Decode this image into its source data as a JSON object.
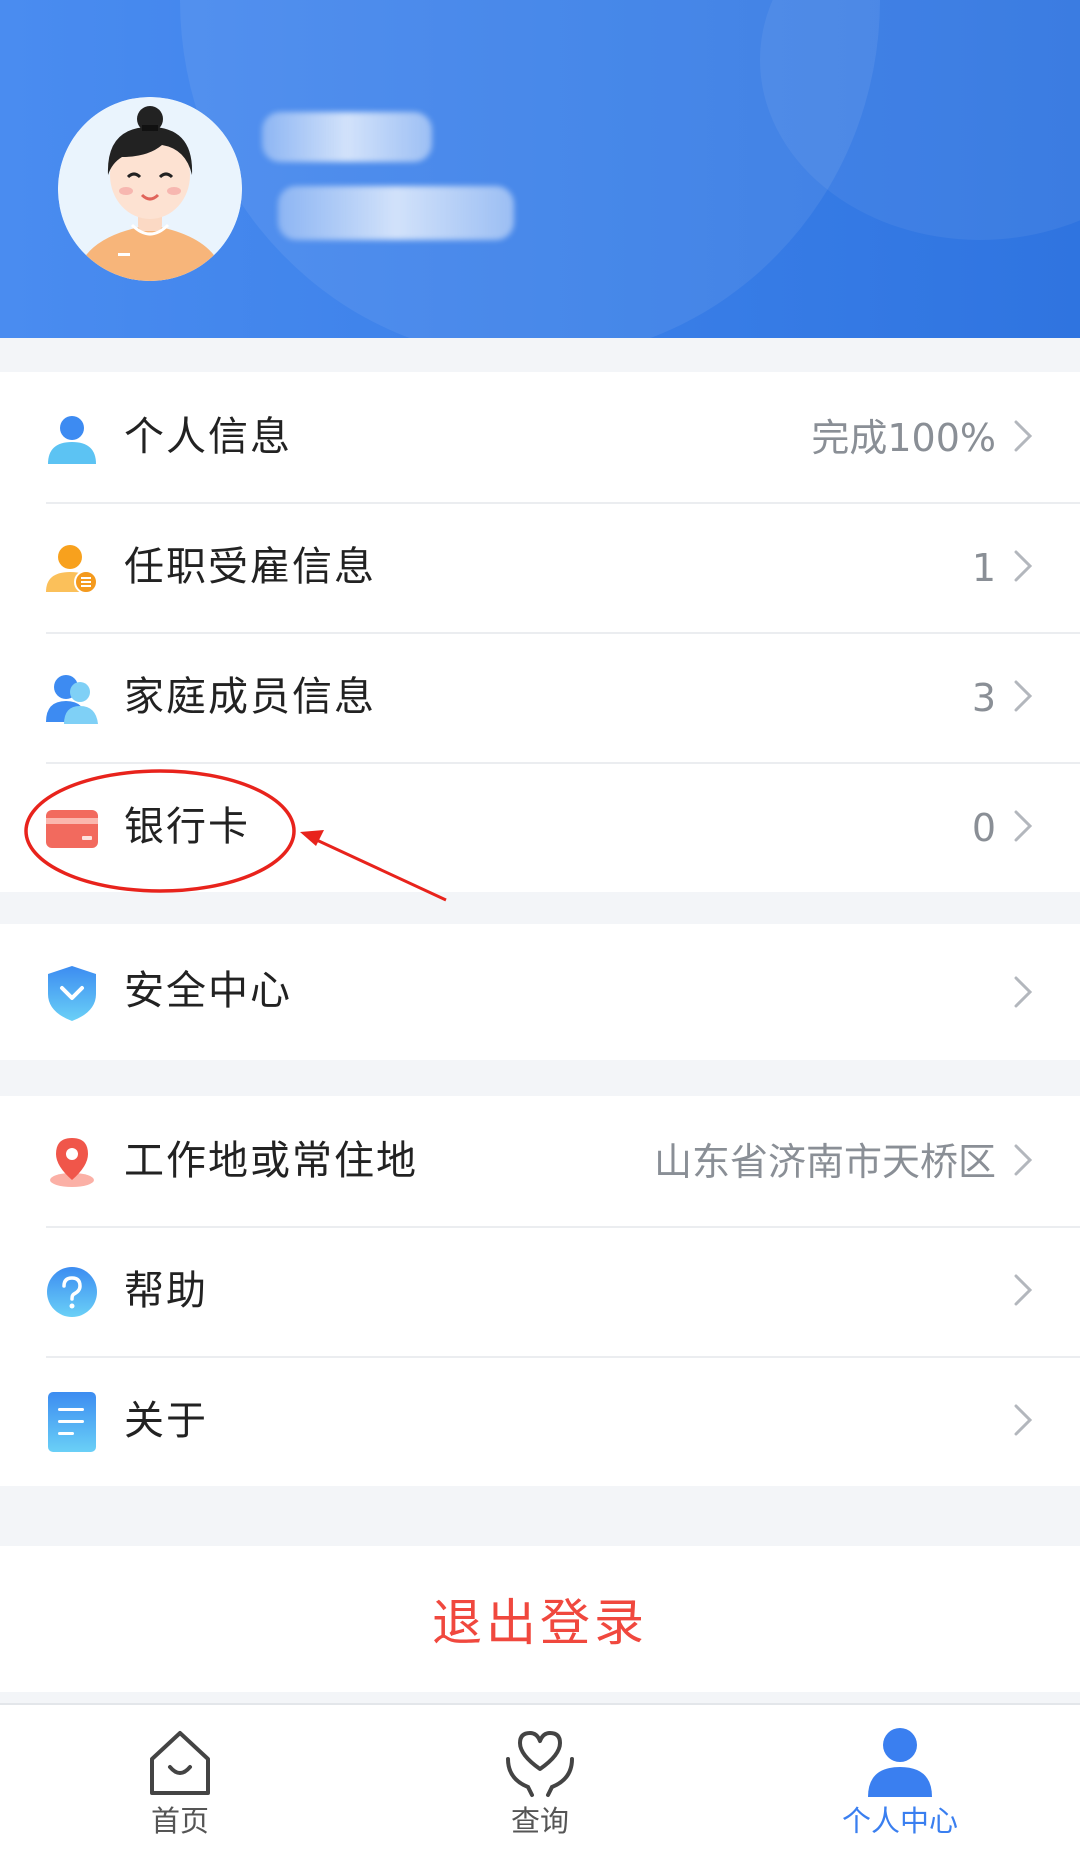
{
  "menu_group_1": [
    {
      "label": "个人信息",
      "value": "完成100%",
      "icon": "person-icon"
    },
    {
      "label": "任职受雇信息",
      "value": "1",
      "icon": "employment-icon"
    },
    {
      "label": "家庭成员信息",
      "value": "3",
      "icon": "family-icon"
    },
    {
      "label": "银行卡",
      "value": "0",
      "icon": "bank-card-icon"
    }
  ],
  "menu_group_2": [
    {
      "label": "安全中心",
      "value": "",
      "icon": "shield-icon"
    }
  ],
  "menu_group_3": [
    {
      "label": "工作地或常住地",
      "value": "山东省济南市天桥区",
      "icon": "location-pin-icon"
    },
    {
      "label": "帮助",
      "value": "",
      "icon": "help-icon"
    },
    {
      "label": "关于",
      "value": "",
      "icon": "document-icon"
    }
  ],
  "logout_label": "退出登录",
  "tabs": [
    {
      "label": "首页",
      "icon": "home-icon",
      "active": false
    },
    {
      "label": "查询",
      "icon": "query-heart-icon",
      "active": false
    },
    {
      "label": "个人中心",
      "icon": "profile-icon",
      "active": true
    }
  ],
  "colors": {
    "header_blue": "#3a7fe8",
    "accent_blue": "#3a7ff0",
    "logout_red": "#f0483e",
    "annotation_red": "#e8231c"
  }
}
